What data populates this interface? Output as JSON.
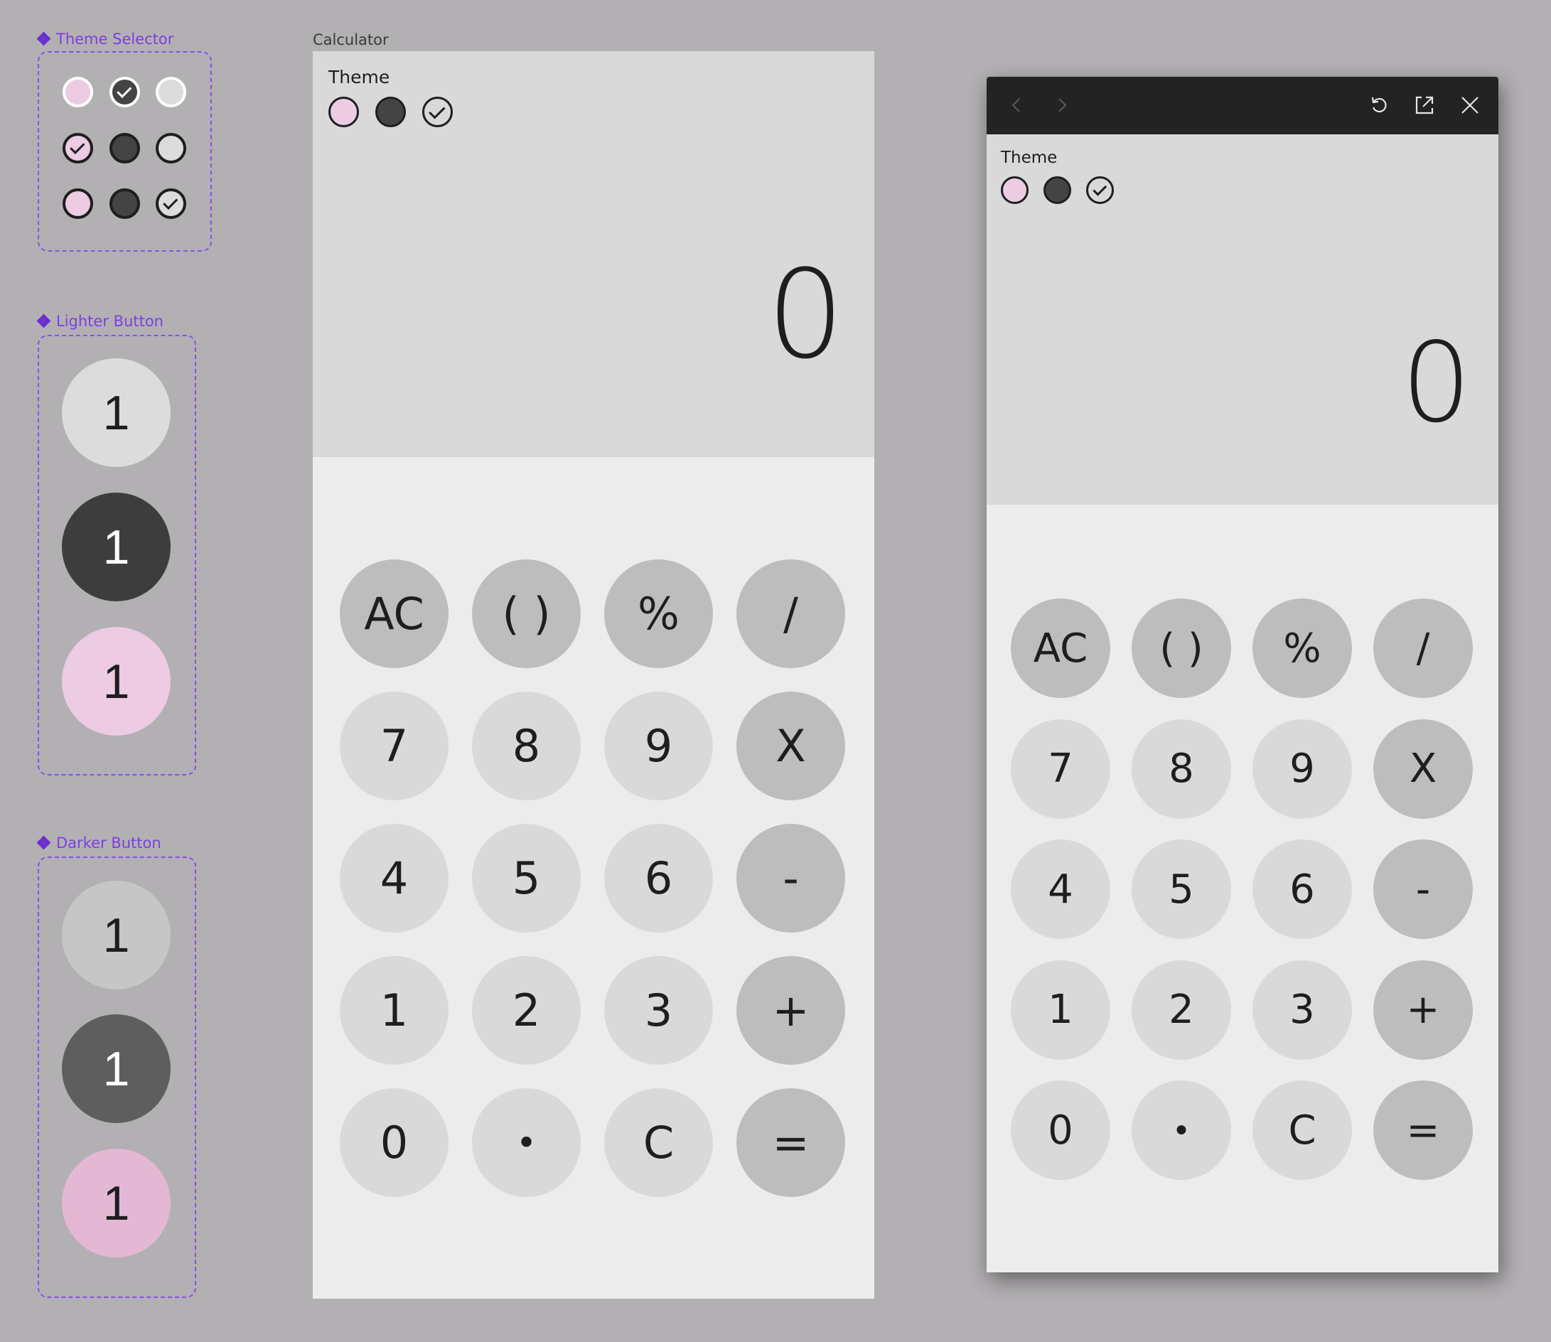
{
  "components": {
    "theme_selector": {
      "label": "Theme Selector",
      "rows": [
        {
          "selected": "dark",
          "border": "white"
        },
        {
          "selected": "pink",
          "border": "black"
        },
        {
          "selected": "light",
          "border": "black"
        }
      ]
    },
    "lighter_button": {
      "label": "Lighter Button",
      "buttons": [
        {
          "variant": "light",
          "text": "1"
        },
        {
          "variant": "dark",
          "text": "1"
        },
        {
          "variant": "pink",
          "text": "1"
        }
      ]
    },
    "darker_button": {
      "label": "Darker Button",
      "buttons": [
        {
          "variant": "light",
          "text": "1"
        },
        {
          "variant": "dark",
          "text": "1"
        },
        {
          "variant": "pink",
          "text": "1"
        }
      ]
    }
  },
  "calculator": {
    "frame_title": "Calculator",
    "theme_label": "Theme",
    "theme_options": [
      "pink",
      "dark",
      "light"
    ],
    "selected_theme": "light",
    "display_value": "0",
    "keys": [
      {
        "label": "AC",
        "type": "op"
      },
      {
        "label": "( )",
        "type": "op"
      },
      {
        "label": "%",
        "type": "op"
      },
      {
        "label": "/",
        "type": "op"
      },
      {
        "label": "7",
        "type": "num"
      },
      {
        "label": "8",
        "type": "num"
      },
      {
        "label": "9",
        "type": "num"
      },
      {
        "label": "X",
        "type": "op"
      },
      {
        "label": "4",
        "type": "num"
      },
      {
        "label": "5",
        "type": "num"
      },
      {
        "label": "6",
        "type": "num"
      },
      {
        "label": "-",
        "type": "op"
      },
      {
        "label": "1",
        "type": "num"
      },
      {
        "label": "2",
        "type": "num"
      },
      {
        "label": "3",
        "type": "num"
      },
      {
        "label": "+",
        "type": "op"
      },
      {
        "label": "0",
        "type": "num"
      },
      {
        "label": "•",
        "type": "num"
      },
      {
        "label": "C",
        "type": "num"
      },
      {
        "label": "=",
        "type": "op"
      }
    ]
  },
  "preview_window": {
    "toolbar": {
      "back_icon": "chevron-left-icon",
      "forward_icon": "chevron-right-icon",
      "reload_icon": "reload-icon",
      "open_external_icon": "open-external-icon",
      "close_icon": "close-icon"
    },
    "theme_label": "Theme",
    "selected_theme": "light",
    "display_value": "0"
  },
  "colors": {
    "canvas": "#b3b0b3",
    "component_outline": "#8a4ff0",
    "component_label": "#7b3fe0",
    "pink": "#eccbe3",
    "pink_darker": "#e4b8d4",
    "dark": "#444444",
    "dark_darker": "#5e5e5e",
    "light": "#dcdcdc",
    "light_darker": "#c6c6c6",
    "key_number": "#d9d9d9",
    "key_operator": "#bdbdbd",
    "display_bg": "#d9d9d9",
    "keypad_bg": "#ececec",
    "titlebar": "#232323"
  }
}
